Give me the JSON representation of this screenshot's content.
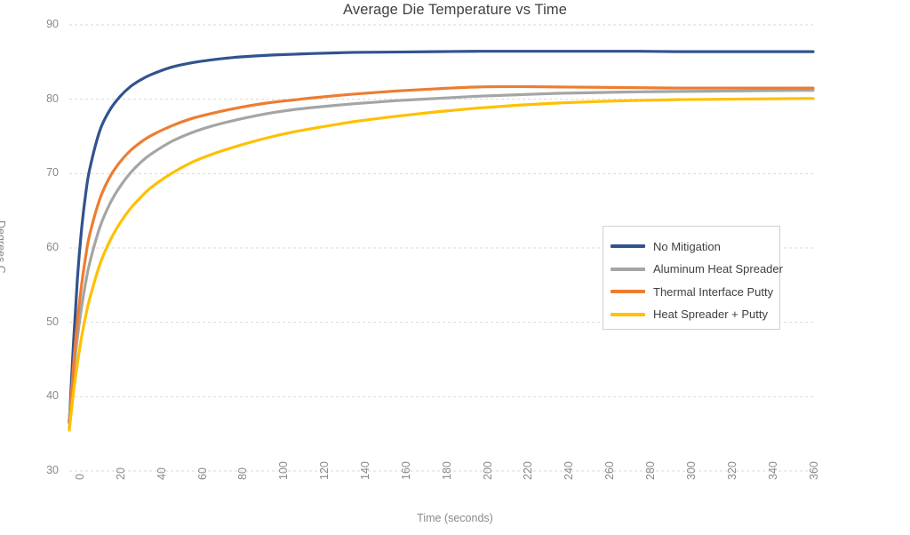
{
  "chart_data": {
    "type": "line",
    "title": "Average Die Temperature vs Time",
    "xlabel": "Time (seconds)",
    "ylabel": "Degrees C",
    "xlim": [
      0,
      365
    ],
    "ylim": [
      30,
      90
    ],
    "grid": true,
    "grid_axis": "y",
    "legend_position": "center-right-inside",
    "xticks": [
      0,
      20,
      40,
      60,
      80,
      100,
      120,
      140,
      160,
      180,
      200,
      220,
      240,
      260,
      280,
      300,
      320,
      340,
      360
    ],
    "yticks": [
      30,
      40,
      50,
      60,
      70,
      80,
      90
    ],
    "x": [
      0,
      2,
      4,
      6,
      8,
      10,
      15,
      20,
      25,
      30,
      35,
      40,
      50,
      60,
      70,
      80,
      90,
      100,
      110,
      120,
      140,
      160,
      180,
      200,
      220,
      240,
      260,
      280,
      300,
      320,
      340,
      360,
      365
    ],
    "series": [
      {
        "name": "No Mitigation",
        "color": "#31538F",
        "values": [
          36.5,
          47.0,
          56.0,
          62.5,
          67.2,
          70.6,
          75.8,
          78.6,
          80.4,
          81.7,
          82.6,
          83.3,
          84.3,
          84.9,
          85.3,
          85.6,
          85.8,
          85.95,
          86.05,
          86.15,
          86.3,
          86.35,
          86.4,
          86.45,
          86.45,
          86.45,
          86.45,
          86.45,
          86.4,
          86.4,
          86.4,
          86.4,
          86.4
        ]
      },
      {
        "name": "Aluminum Heat Spreader",
        "color": "#A5A5A5",
        "values": [
          37.2,
          43.0,
          48.0,
          52.0,
          55.3,
          58.0,
          62.8,
          66.0,
          68.3,
          70.1,
          71.5,
          72.6,
          74.3,
          75.5,
          76.4,
          77.1,
          77.7,
          78.2,
          78.6,
          78.9,
          79.4,
          79.8,
          80.1,
          80.4,
          80.6,
          80.8,
          80.9,
          81.0,
          81.05,
          81.1,
          81.15,
          81.2,
          81.2
        ]
      },
      {
        "name": "Thermal Interface Putty",
        "color": "#ED7D31",
        "values": [
          35.6,
          44.0,
          50.2,
          55.0,
          58.8,
          61.8,
          66.6,
          69.6,
          71.6,
          73.1,
          74.2,
          75.1,
          76.4,
          77.4,
          78.1,
          78.7,
          79.2,
          79.6,
          79.9,
          80.2,
          80.7,
          81.1,
          81.4,
          81.65,
          81.7,
          81.65,
          81.6,
          81.55,
          81.5,
          81.5,
          81.5,
          81.5,
          81.5
        ]
      },
      {
        "name": "Heat Spreader + Putty",
        "color": "#FFC000",
        "values": [
          35.5,
          40.5,
          44.5,
          48.0,
          50.8,
          53.2,
          57.8,
          61.0,
          63.4,
          65.3,
          66.8,
          68.1,
          70.0,
          71.5,
          72.6,
          73.5,
          74.3,
          75.0,
          75.6,
          76.1,
          77.0,
          77.7,
          78.3,
          78.8,
          79.2,
          79.5,
          79.7,
          79.85,
          79.95,
          80.0,
          80.05,
          80.1,
          80.1
        ]
      }
    ]
  },
  "legend": {
    "items": [
      {
        "label": "No Mitigation",
        "color": "#31538F"
      },
      {
        "label": "Aluminum Heat Spreader",
        "color": "#A5A5A5"
      },
      {
        "label": "Thermal Interface Putty",
        "color": "#ED7D31"
      },
      {
        "label": "Heat Spreader + Putty",
        "color": "#FFC000"
      }
    ]
  }
}
